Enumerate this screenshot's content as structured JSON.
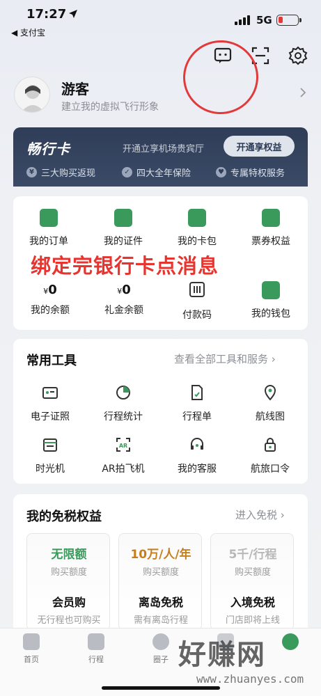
{
  "status_bar": {
    "time": "17:27",
    "back_app": "◀ 支付宝",
    "network": "5G"
  },
  "profile": {
    "name": "游客",
    "subtitle": "建立我的虚拟飞行形象"
  },
  "card": {
    "name": "畅行卡",
    "description": "开通立享机场贵宾厅",
    "button": "开通享权益",
    "perks": [
      "三大购买返现",
      "四大全年保险",
      "专属特权服务"
    ],
    "perk_icons": [
      "¥",
      "✓",
      "♥"
    ]
  },
  "quick_grid": [
    {
      "label": "我的订单",
      "icon": "order-icon"
    },
    {
      "label": "我的证件",
      "icon": "id-card-icon"
    },
    {
      "label": "我的卡包",
      "icon": "card-wallet-icon"
    },
    {
      "label": "票券权益",
      "icon": "ticket-icon"
    }
  ],
  "overlay_note": "绑定完银行卡点消息",
  "wallet_grid": [
    {
      "currency": "¥",
      "amount": "0",
      "label": "我的余额"
    },
    {
      "currency": "¥",
      "amount": "0",
      "label": "礼金余额"
    },
    {
      "label": "付款码",
      "icon": "pay-code-icon"
    },
    {
      "label": "我的钱包",
      "icon": "wallet-icon"
    }
  ],
  "tools": {
    "title": "常用工具",
    "link": "查看全部工具和服务",
    "items": [
      {
        "label": "电子证照",
        "icon": "e-license-icon"
      },
      {
        "label": "行程统计",
        "icon": "pie-chart-icon"
      },
      {
        "label": "行程单",
        "icon": "itinerary-icon"
      },
      {
        "label": "航线图",
        "icon": "location-pin-icon"
      },
      {
        "label": "时光机",
        "icon": "calendar-icon"
      },
      {
        "label": "AR拍飞机",
        "icon": "ar-icon"
      },
      {
        "label": "我的客服",
        "icon": "headset-icon"
      },
      {
        "label": "航旅口令",
        "icon": "lock-icon"
      }
    ]
  },
  "duty_free": {
    "title": "我的免税权益",
    "link": "进入免税",
    "cards": [
      {
        "head": "无限额",
        "sub": "购买额度",
        "title": "会员购",
        "desc": "无行程也可购买",
        "color": "#3a9a5c"
      },
      {
        "head": "10万/人/年",
        "sub": "购买额度",
        "title": "离岛免税",
        "desc": "需有离岛行程",
        "color": "#c77d1e"
      },
      {
        "head": "5千/行程",
        "sub": "购买额度",
        "title": "入境免税",
        "desc": "门店即将上线",
        "color": "#b8b8b8"
      }
    ]
  },
  "bottom_nav": [
    "首页",
    "行程",
    "圈子",
    "",
    ""
  ],
  "watermark": {
    "text": "好赚网",
    "url": "www.zhuanyes.com"
  }
}
